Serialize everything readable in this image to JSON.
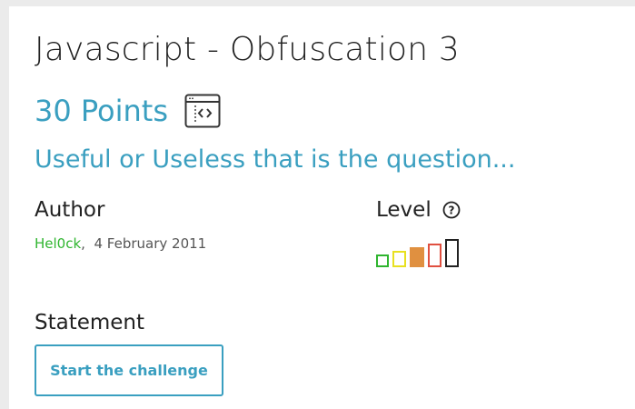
{
  "challenge": {
    "title": "Javascript - Obfuscation 3",
    "points": "30 Points",
    "type_icon": "code-window-icon",
    "subtitle": "Useful or Useless that is the question..."
  },
  "author": {
    "label": "Author",
    "name": "Hel0ck",
    "separator": ",",
    "date": "4 February 2011"
  },
  "level": {
    "label": "Level",
    "help_icon": "question-mark-icon",
    "current": 3,
    "max": 5,
    "colors": [
      "#2fb52f",
      "#e8e020",
      "#e09040",
      "#e05040",
      "#222222"
    ]
  },
  "statement": {
    "label": "Statement",
    "button_label": "Start the challenge"
  },
  "colors": {
    "accent": "#3a9fc0",
    "author_link": "#2fb52f",
    "background": "#ebebeb"
  }
}
